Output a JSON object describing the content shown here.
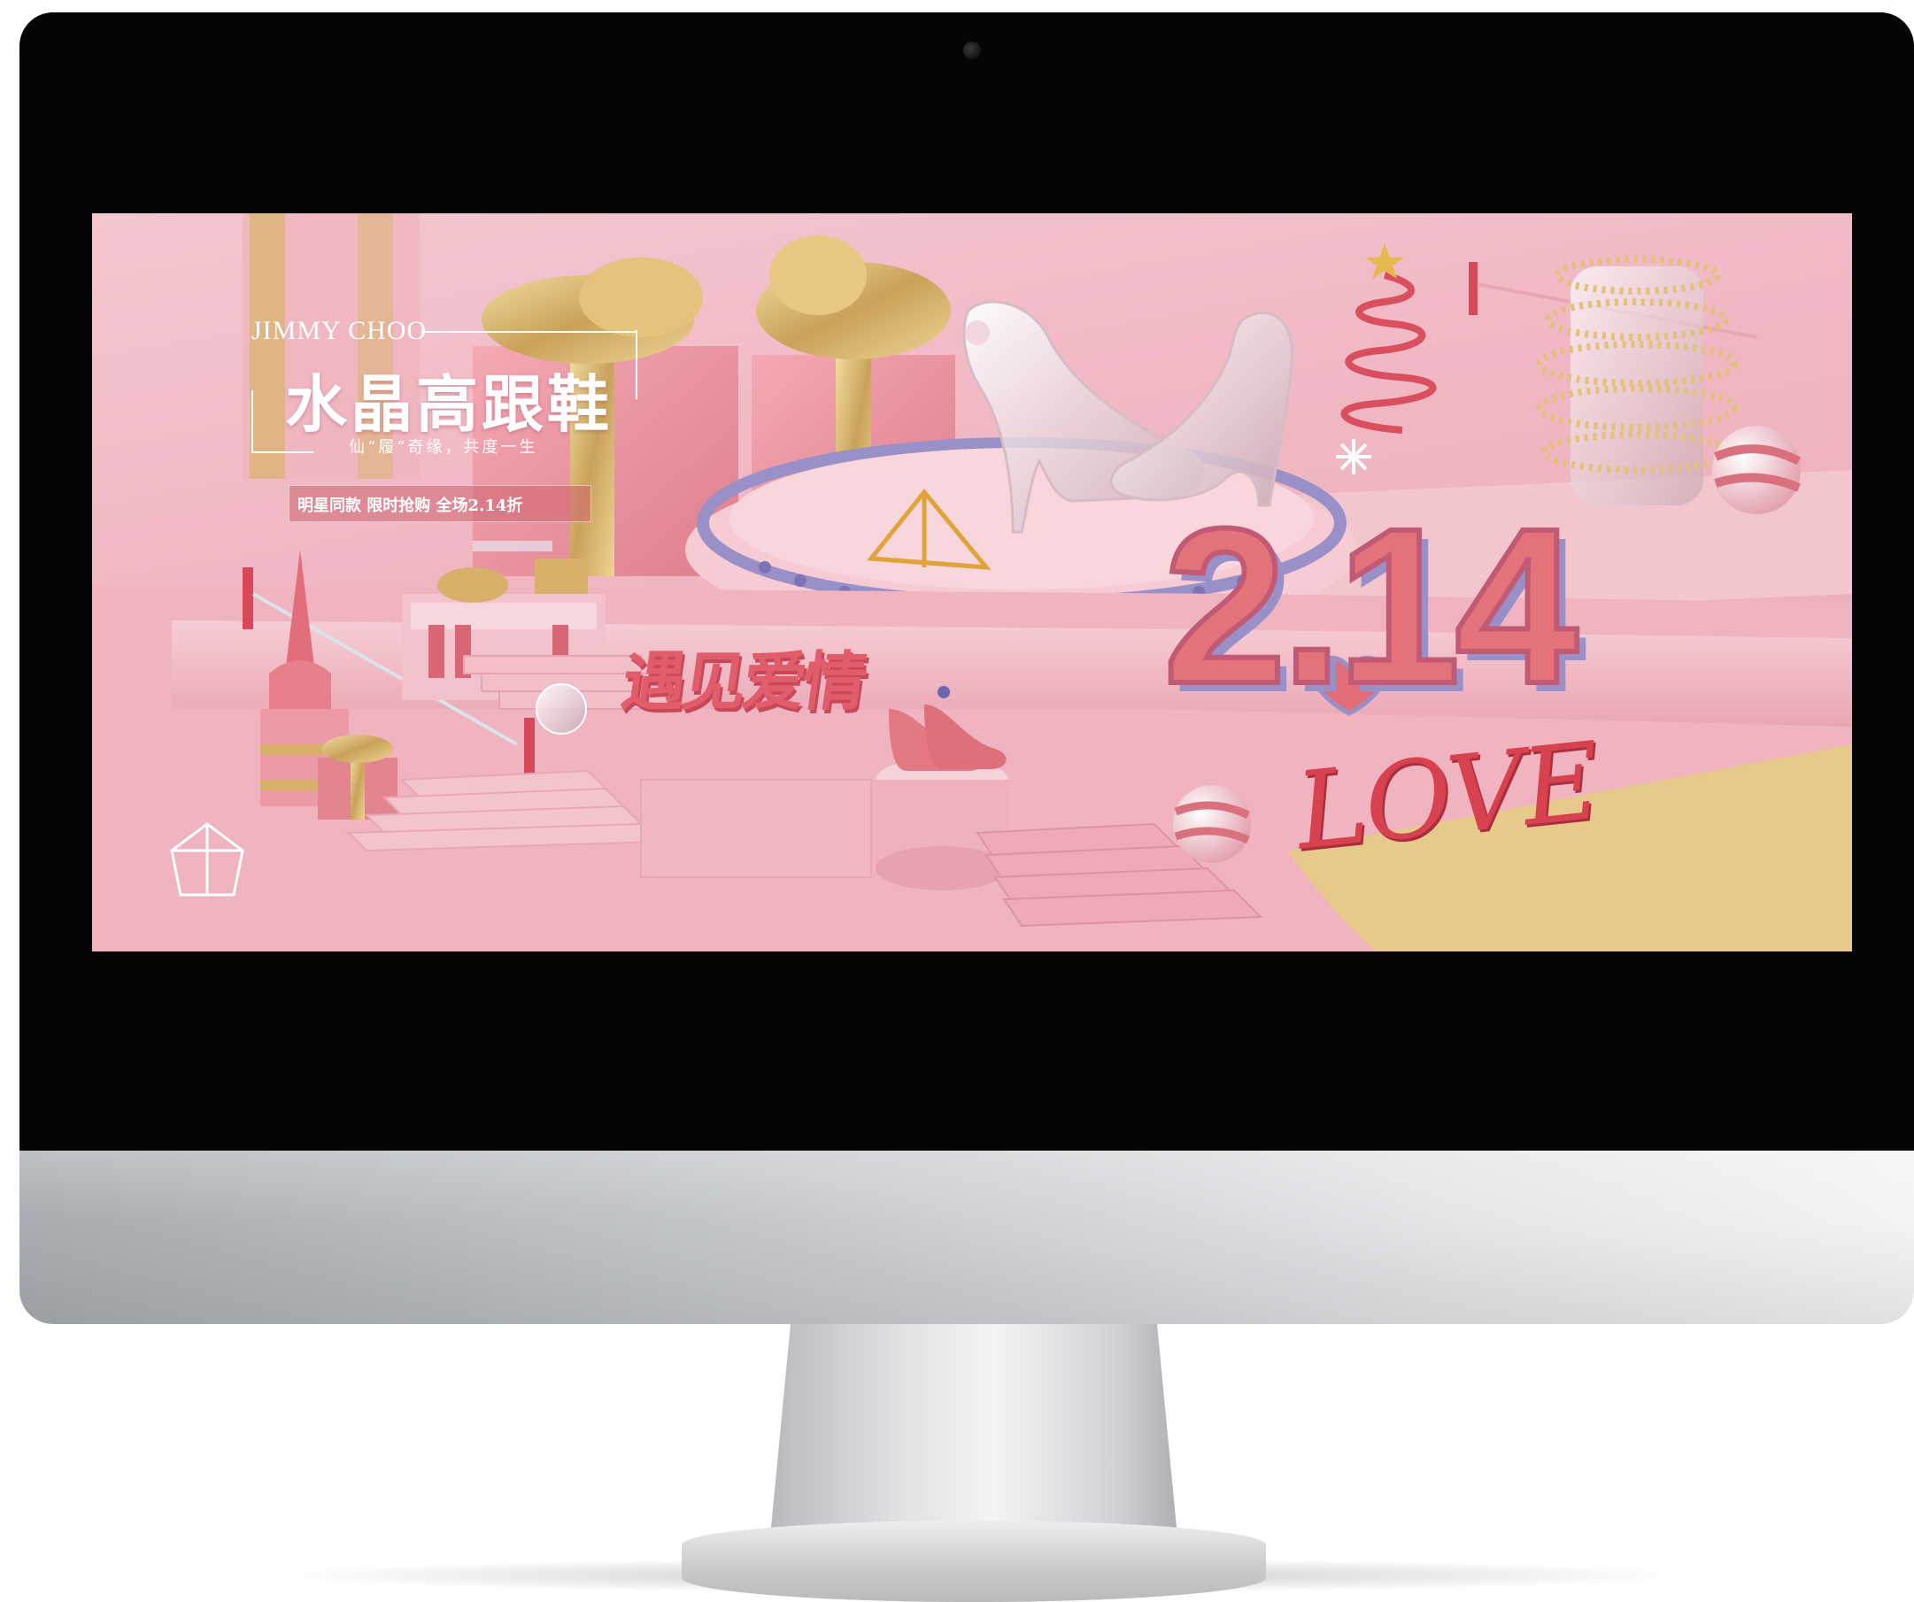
{
  "banner": {
    "brand": "JIMMY CHOO",
    "title": "水晶高跟鞋",
    "subtitle": "仙“履”奇缘，共度一生",
    "promo": "明星同款 限时抢购 全场2.14折",
    "headline_cn": "遇见爱情",
    "date_graphic": "2.14",
    "script_word": "LOVE"
  },
  "colors": {
    "screen_pink": "#f0b7c3",
    "accent_red": "#e25d6c",
    "gold": "#d6b46a",
    "lavender": "#9a90c8"
  },
  "icons": [
    "webcam-icon",
    "gift-box-icon",
    "crystal-shoe-icon",
    "star-icon",
    "heart-icon",
    "geometric-diamond-icon"
  ]
}
